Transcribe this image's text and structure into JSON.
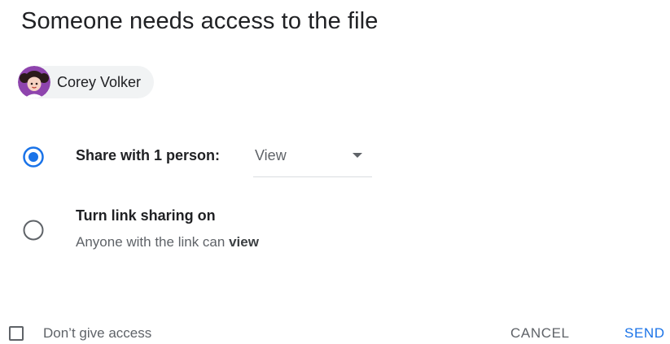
{
  "dialog": {
    "title": "Someone needs access to the file"
  },
  "requester": {
    "name": "Corey Volker",
    "avatar_icon": "avatar-girl-icon"
  },
  "options": {
    "share_with_person": {
      "label": "Share with 1 person:",
      "selected": true,
      "permission": "View"
    },
    "link_sharing": {
      "label": "Turn link sharing on",
      "selected": false,
      "description_prefix": "Anyone with the link can ",
      "description_emphasis": "view"
    }
  },
  "footer": {
    "dont_give_access": {
      "label": "Don’t give access",
      "checked": false
    },
    "cancel_label": "CANCEL",
    "send_label": "SEND"
  },
  "colors": {
    "accent": "#1a73e8",
    "chip_bg": "#f1f3f4",
    "avatar_bg": "#8e44ad",
    "text_primary": "#202124",
    "text_secondary": "#5f6368"
  }
}
